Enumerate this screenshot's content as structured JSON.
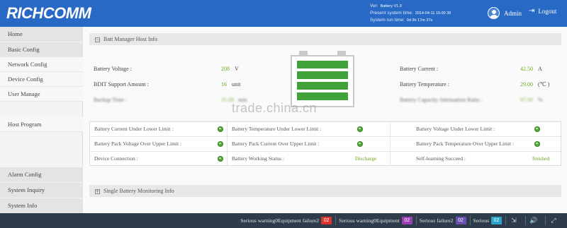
{
  "header": {
    "logo": "RICHCOMM",
    "version_label": "Ver:",
    "version_value": "Battery V1.0",
    "present_time_label": "Present system time:",
    "present_time_value": "2014-04-11 15:00 39",
    "run_time_label": "System run time:",
    "run_time_value": "0d 3h 17m 37s",
    "user": "Admin",
    "logout": "Logout",
    "colors": {
      "bar": "#2869c6"
    }
  },
  "sidebar": {
    "items": [
      {
        "label": "Home"
      },
      {
        "label": "Basic Config"
      },
      {
        "label": "Network Config"
      },
      {
        "label": "Device Config"
      },
      {
        "label": "User Manage"
      },
      {
        "label": "Host Program"
      },
      {
        "label": "Alarm Config"
      },
      {
        "label": "System Inquiry"
      },
      {
        "label": "System Info"
      }
    ]
  },
  "main": {
    "section1_title": "Batt Manager Host Info",
    "section2_title": "Single Battery Monitoring Info",
    "fields": {
      "battery_voltage": {
        "label": "Battery Voltage :",
        "value": "208",
        "unit": "V"
      },
      "bdit_support": {
        "label": "BDIT Support Amount :",
        "value": "16",
        "unit": "unit"
      },
      "backup_time": {
        "label": "Backup Time :",
        "value": "35.00",
        "unit": "min"
      },
      "battery_current": {
        "label": "Battery Current :",
        "value": "42.50",
        "unit": "A"
      },
      "battery_temperature": {
        "label": "Battery Temperature :",
        "value": "29.00",
        "unit": "(℃ )"
      },
      "capacity_attenuation": {
        "label": "Battery Capacity Attenuation Ratio :",
        "value": "87.00",
        "unit": "%"
      }
    },
    "battery_icon": "battery-level-icon",
    "watermark": "trade.china.cn",
    "status_rows": [
      [
        {
          "label": "Battery Current Under Lower Limit :",
          "icon": "status-ok-icon"
        },
        {
          "label": "Battery Temperature Under Lower Limit :",
          "icon": "status-ok-icon"
        },
        {
          "label": "Battery Voltage Under Lower Limit :",
          "icon": "status-ok-icon"
        }
      ],
      [
        {
          "label": "Battery Pack Voltage Over Upper Limit :",
          "icon": "status-ok-icon"
        },
        {
          "label": "Battery Pack Current Over Upper Limit :",
          "icon": "status-ok-icon"
        },
        {
          "label": "Battery Pack Temperature Over Upper Limit :",
          "icon": "status-ok-icon"
        }
      ],
      [
        {
          "label": "Device Connection :",
          "icon": "status-ok-icon"
        },
        {
          "label": "Battery Working Status :",
          "value": "Discharge"
        },
        {
          "label": "Self-learning Succeed :",
          "value": "finished"
        }
      ]
    ],
    "colors": {
      "value_green": "#6aaa1e",
      "status_dot": "#52a83a"
    }
  },
  "footer": {
    "alarms": [
      {
        "label": "Serious warning0Equipment failure2",
        "count": "02",
        "color": "#d9332b"
      },
      {
        "label": "Serious warning0Equipment",
        "count": "02",
        "color": "#9b3fb5"
      },
      {
        "label": "Serious failure2",
        "count": "02",
        "color": "#6a4fb0"
      },
      {
        "label": "Serious",
        "count": "02",
        "color": "#2aa5c9"
      }
    ],
    "icons": [
      "export-icon",
      "volume-icon",
      "expand-icon"
    ]
  }
}
